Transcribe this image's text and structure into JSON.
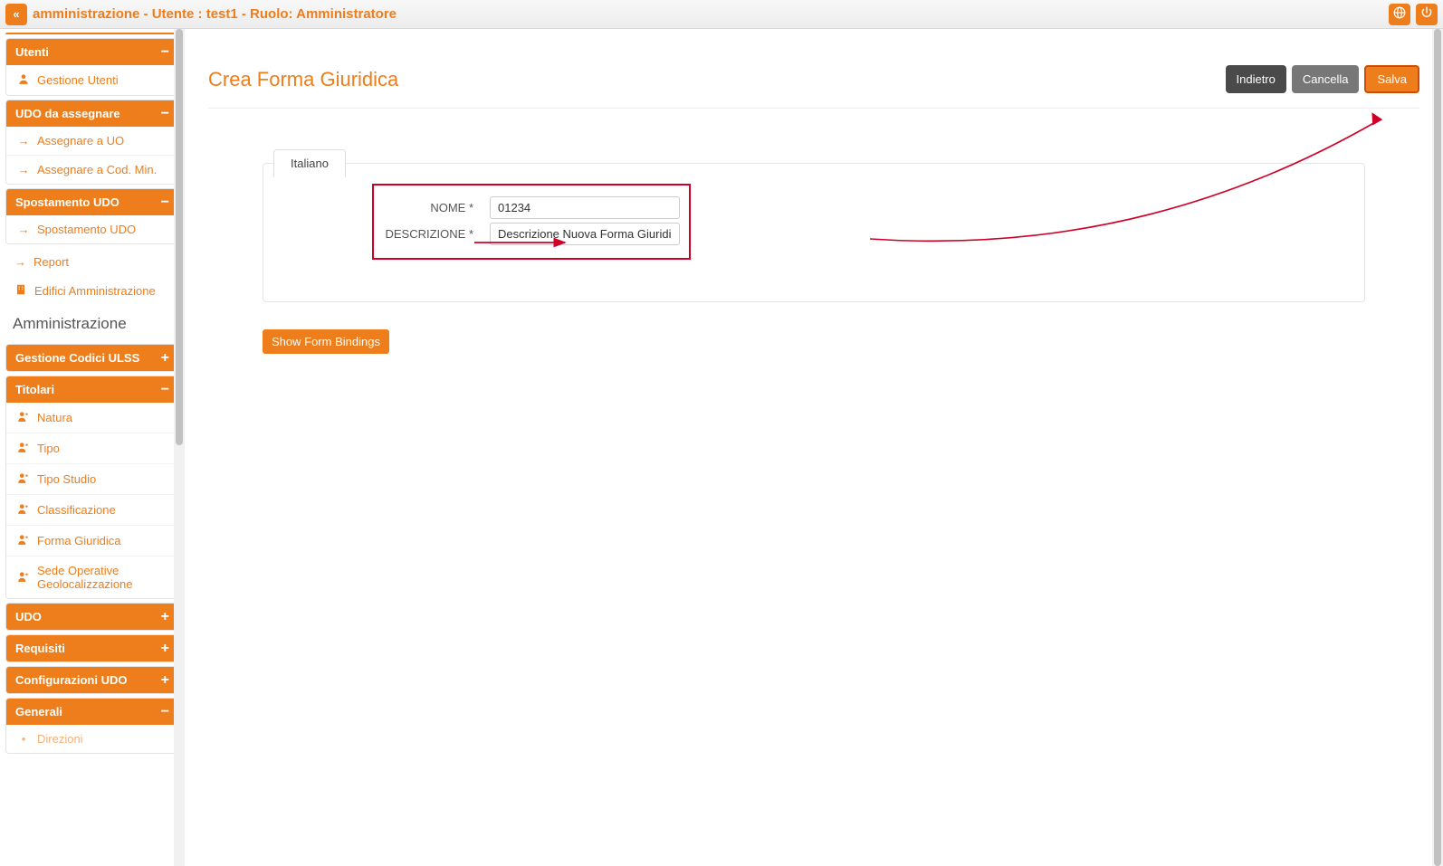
{
  "topbar": {
    "title": "amministrazione - Utente : test1 - Ruolo: Amministratore"
  },
  "sidebar": {
    "utenti": {
      "title": "Utenti",
      "items": [
        "Gestione Utenti"
      ]
    },
    "udo_assegnare": {
      "title": "UDO da assegnare",
      "items": [
        "Assegnare a UO",
        "Assegnare a Cod. Min."
      ]
    },
    "spostamento": {
      "title": "Spostamento UDO",
      "items": [
        "Spostamento UDO"
      ]
    },
    "plain": {
      "report": "Report",
      "edifici": "Edifici Amministrazione"
    },
    "section": "Amministrazione",
    "codici_ulss": {
      "title": "Gestione Codici ULSS"
    },
    "titolari": {
      "title": "Titolari",
      "items": [
        "Natura",
        "Tipo",
        "Tipo Studio",
        "Classificazione",
        "Forma Giuridica",
        "Sede Operative Geolocalizzazione"
      ]
    },
    "udo": {
      "title": "UDO"
    },
    "requisiti": {
      "title": "Requisiti"
    },
    "config_udo": {
      "title": "Configurazioni UDO"
    },
    "generali": {
      "title": "Generali",
      "items": [
        "Direzioni"
      ]
    }
  },
  "page": {
    "title": "Crea Forma Giuridica",
    "actions": {
      "indietro": "Indietro",
      "cancella": "Cancella",
      "salva": "Salva"
    },
    "tab": "Italiano",
    "form": {
      "nome_label": "NOME *",
      "nome_value": "01234",
      "descrizione_label": "DESCRIZIONE *",
      "descrizione_value": "Descrizione Nuova Forma Giuridica"
    },
    "show_bindings": "Show Form Bindings"
  }
}
